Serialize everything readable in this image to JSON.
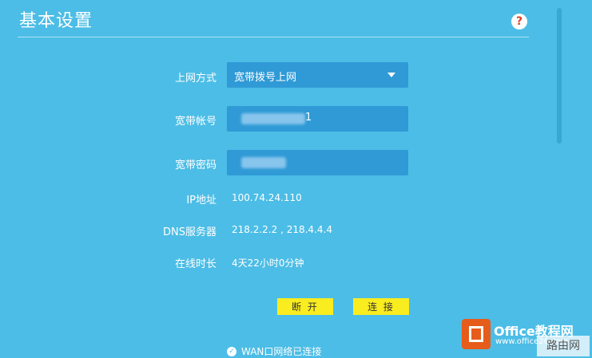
{
  "header": {
    "title": "基本设置",
    "help": "?"
  },
  "form": {
    "connection_type": {
      "label": "上网方式",
      "value": "宽带拨号上网"
    },
    "account": {
      "label": "宽带帐号",
      "value_tail": "1"
    },
    "password": {
      "label": "宽带密码"
    },
    "ip": {
      "label": "IP地址",
      "value": "100.74.24.110"
    },
    "dns": {
      "label": "DNS服务器",
      "value": "218.2.2.2 , 218.4.4.4"
    },
    "uptime": {
      "label": "在线时长",
      "value": "4天22小时0分钟"
    }
  },
  "buttons": {
    "disconnect": "断 开",
    "connect": "连 接"
  },
  "status": {
    "text": "WAN口网络已连接",
    "icon": "check-circle-icon"
  },
  "watermark": {
    "title": "Office教程网",
    "url": "www.office26.com",
    "corner": "路由网"
  },
  "colors": {
    "background": "#4cbde6",
    "field": "#2f9ad6",
    "button": "#f9ec1f"
  }
}
